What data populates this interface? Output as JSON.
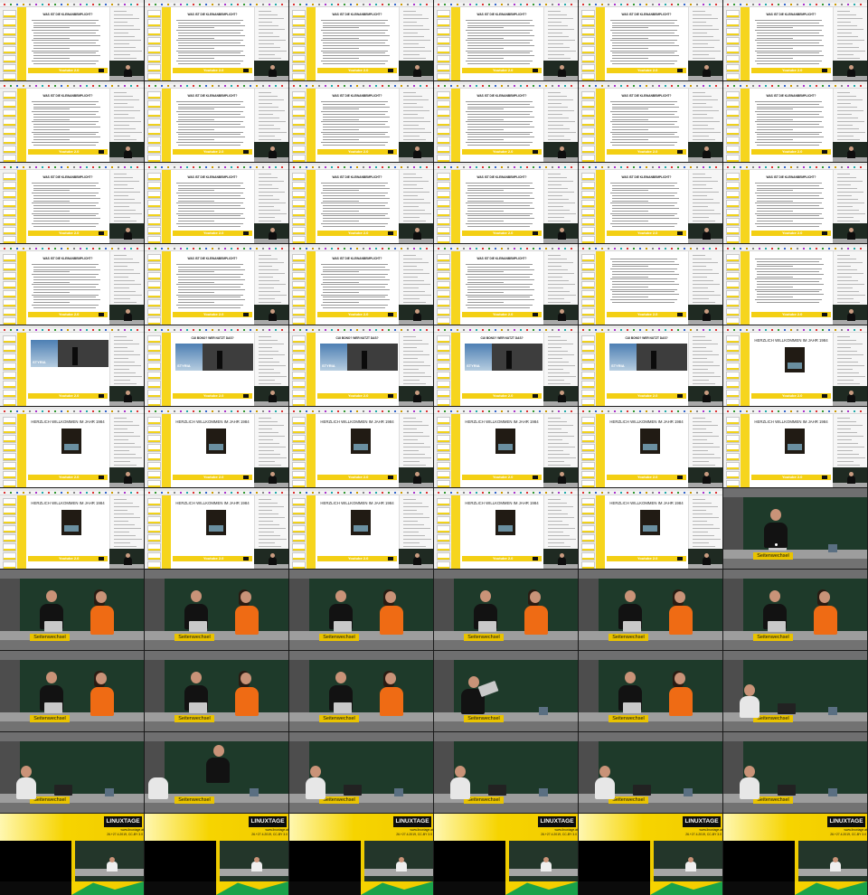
{
  "grid": {
    "columns": 6,
    "rows": 11
  },
  "slide_titles": {
    "agenda": "WAS IST DIE KLEINANBEMPLICHT?",
    "brand": "Youtube 2.0",
    "styria": "STYRIA",
    "styria_caption": "CUI BONO? WER NUTZT DAS?",
    "year": "HERZLICH WILLKOMMEN IM JAHR 1984"
  },
  "camera": {
    "sign_label": "Seitenwechsel"
  },
  "lower_third": {
    "logo": "LINUXTAGE",
    "url": "www.linuxtage.at",
    "dates": "26.+27.4.2019, CC-BY 3.0"
  },
  "colors": {
    "accent": "#f6d400",
    "shirt": "#ef6b14",
    "board": "#1e3a2a"
  },
  "tiles": [
    {
      "kind": "text"
    },
    {
      "kind": "text"
    },
    {
      "kind": "text"
    },
    {
      "kind": "text"
    },
    {
      "kind": "text"
    },
    {
      "kind": "text"
    },
    {
      "kind": "text"
    },
    {
      "kind": "text"
    },
    {
      "kind": "text"
    },
    {
      "kind": "text"
    },
    {
      "kind": "text"
    },
    {
      "kind": "text"
    },
    {
      "kind": "text"
    },
    {
      "kind": "text"
    },
    {
      "kind": "text"
    },
    {
      "kind": "text"
    },
    {
      "kind": "text"
    },
    {
      "kind": "text"
    },
    {
      "kind": "text"
    },
    {
      "kind": "text"
    },
    {
      "kind": "text"
    },
    {
      "kind": "text"
    },
    {
      "kind": "text2"
    },
    {
      "kind": "text2"
    },
    {
      "kind": "photo"
    },
    {
      "kind": "photo_cap"
    },
    {
      "kind": "photo_cap"
    },
    {
      "kind": "photo_cap"
    },
    {
      "kind": "photo_cap"
    },
    {
      "kind": "year"
    },
    {
      "kind": "year"
    },
    {
      "kind": "year"
    },
    {
      "kind": "year"
    },
    {
      "kind": "year"
    },
    {
      "kind": "year"
    },
    {
      "kind": "year"
    },
    {
      "kind": "year"
    },
    {
      "kind": "year"
    },
    {
      "kind": "year"
    },
    {
      "kind": "year"
    },
    {
      "kind": "year"
    },
    {
      "kind": "cam_one"
    },
    {
      "kind": "cam_two"
    },
    {
      "kind": "cam_two"
    },
    {
      "kind": "cam_two"
    },
    {
      "kind": "cam_two"
    },
    {
      "kind": "cam_two"
    },
    {
      "kind": "cam_two"
    },
    {
      "kind": "cam_two"
    },
    {
      "kind": "cam_two"
    },
    {
      "kind": "cam_two"
    },
    {
      "kind": "cam_laptop"
    },
    {
      "kind": "cam_two"
    },
    {
      "kind": "cam_white"
    },
    {
      "kind": "cam_white"
    },
    {
      "kind": "cam_black"
    },
    {
      "kind": "cam_white"
    },
    {
      "kind": "cam_white"
    },
    {
      "kind": "cam_white"
    },
    {
      "kind": "cam_white"
    },
    {
      "kind": "lower"
    },
    {
      "kind": "lower"
    },
    {
      "kind": "lower"
    },
    {
      "kind": "lower"
    },
    {
      "kind": "lower"
    },
    {
      "kind": "lower"
    }
  ]
}
